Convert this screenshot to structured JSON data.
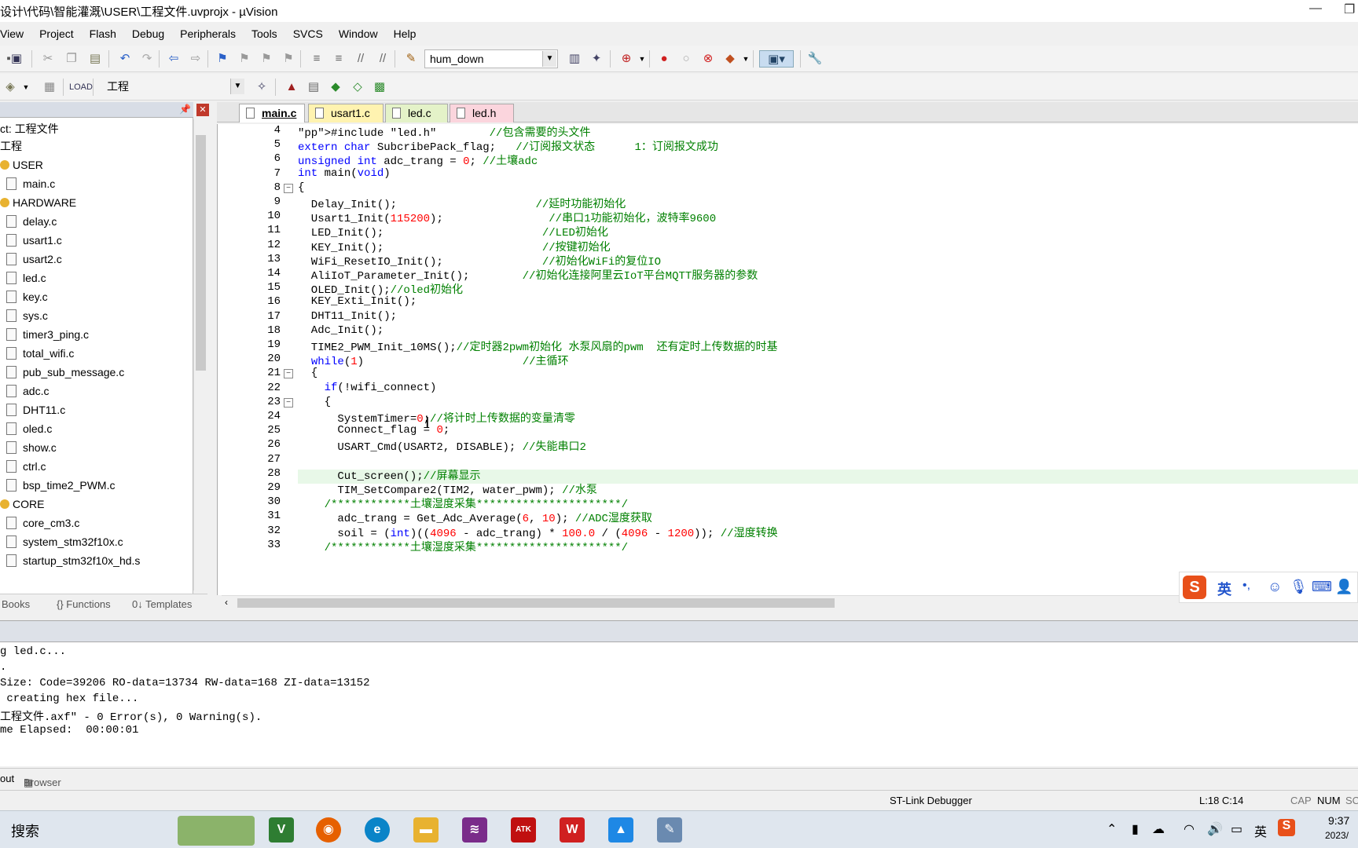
{
  "window": {
    "title": "设计\\代码\\智能灌溉\\USER\\工程文件.uvprojx - µVision",
    "minimize": "—",
    "restore": "❐"
  },
  "menu": [
    "View",
    "Project",
    "Flash",
    "Debug",
    "Peripherals",
    "Tools",
    "SVCS",
    "Window",
    "Help"
  ],
  "toolbar1": {
    "find_combo": "hum_down"
  },
  "toolbar2": {
    "target_combo": "工程"
  },
  "project": {
    "root": "ct: 工程文件",
    "target": "工程",
    "groups": [
      {
        "name": "USER",
        "files": [
          "main.c"
        ]
      },
      {
        "name": "HARDWARE",
        "files": [
          "delay.c",
          "usart1.c",
          "usart2.c",
          "led.c",
          "key.c",
          "sys.c",
          "timer3_ping.c",
          "total_wifi.c",
          "pub_sub_message.c",
          "adc.c",
          "DHT11.c",
          "oled.c",
          "show.c",
          "ctrl.c",
          "bsp_time2_PWM.c"
        ]
      },
      {
        "name": "CORE",
        "files": [
          "core_cm3.c",
          "system_stm32f10x.c",
          "startup_stm32f10x_hd.s"
        ]
      }
    ],
    "tabs": [
      "Books",
      "{} Functions",
      "0↓ Templates"
    ]
  },
  "editor": {
    "tabs": [
      {
        "label": "main.c",
        "color": "#ffffff",
        "active": true
      },
      {
        "label": "usart1.c",
        "color": "#fff3b0",
        "active": false
      },
      {
        "label": "led.c",
        "color": "#e4f2c8",
        "active": false
      },
      {
        "label": "led.h",
        "color": "#fbd5dd",
        "active": false
      }
    ],
    "lines": [
      {
        "n": "4",
        "text": "#include \"led.h\"        //包含需要的头文件"
      },
      {
        "n": "5",
        "text": "extern char SubcribePack_flag;   //订阅报文状态      1：订阅报文成功"
      },
      {
        "n": "6",
        "text": "unsigned int adc_trang = 0; //土壤adc"
      },
      {
        "n": "7",
        "text": "int main(void)"
      },
      {
        "n": "8",
        "text": "{"
      },
      {
        "n": "9",
        "text": "  Delay_Init();                     //延时功能初始化"
      },
      {
        "n": "10",
        "text": "  Usart1_Init(115200);                //串口1功能初始化，波特率9600"
      },
      {
        "n": "11",
        "text": "  LED_Init();                        //LED初始化"
      },
      {
        "n": "12",
        "text": "  KEY_Init();                        //按键初始化"
      },
      {
        "n": "13",
        "text": "  WiFi_ResetIO_Init();               //初始化WiFi的复位IO"
      },
      {
        "n": "14",
        "text": "  AliIoT_Parameter_Init();        //初始化连接阿里云IoT平台MQTT服务器的参数"
      },
      {
        "n": "15",
        "text": "  OLED_Init();//oled初始化"
      },
      {
        "n": "16",
        "text": "  KEY_Exti_Init();"
      },
      {
        "n": "17",
        "text": "  DHT11_Init();"
      },
      {
        "n": "18",
        "text": "  Adc_Init();"
      },
      {
        "n": "19",
        "text": "  TIME2_PWM_Init_10MS();//定时器2pwm初始化 水泵风扇的pwm  还有定时上传数据的时基"
      },
      {
        "n": "20",
        "text": "  while(1)                        //主循环"
      },
      {
        "n": "21",
        "text": "  {"
      },
      {
        "n": "22",
        "text": "    if(!wifi_connect)"
      },
      {
        "n": "23",
        "text": "    {"
      },
      {
        "n": "24",
        "text": "      SystemTimer=0;//将计时上传数据的变量清零"
      },
      {
        "n": "25",
        "text": "      Connect_flag = 0;"
      },
      {
        "n": "26",
        "text": "      USART_Cmd(USART2, DISABLE); //失能串口2"
      },
      {
        "n": "27",
        "text": ""
      },
      {
        "n": "28",
        "text": "      Cut_screen();//屏幕显示"
      },
      {
        "n": "29",
        "text": "      TIM_SetCompare2(TIM2, water_pwm); //水泵"
      },
      {
        "n": "30",
        "text": "    /************土壤湿度采集**********************/"
      },
      {
        "n": "31",
        "text": "      adc_trang = Get_Adc_Average(6, 10); //ADC湿度获取"
      },
      {
        "n": "32",
        "text": "      soil = (int)((4096 - adc_trang) * 100.0 / (4096 - 1200)); //湿度转换"
      },
      {
        "n": "33",
        "text": "    /************土壤湿度采集**********************/"
      }
    ]
  },
  "build_output": [
    "g led.c...",
    ".",
    "Size: Code=39206 RO-data=13734 RW-data=168 ZI-data=13152",
    " creating hex file...",
    "工程文件.axf\" - 0 Error(s), 0 Warning(s).",
    "me Elapsed:  00:00:01"
  ],
  "output_tabs": [
    "out",
    "Browser"
  ],
  "status": {
    "debugger": "ST-Link Debugger",
    "position": "L:18 C:14",
    "cap": "CAP",
    "num": "NUM",
    "scrl": "SC"
  },
  "ime": {
    "lang": "英"
  },
  "taskbar": {
    "search": "搜索",
    "time": "9:37",
    "date": "2023/",
    "ime": "英"
  }
}
